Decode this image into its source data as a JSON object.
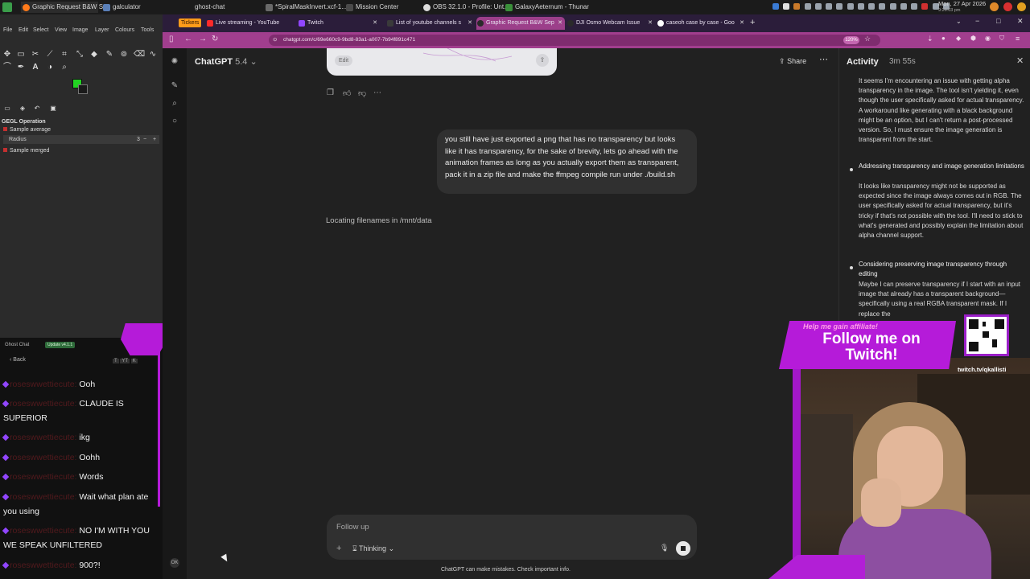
{
  "taskbar": {
    "items": [
      {
        "label": "Graphic Request B&W S...",
        "active": true,
        "color": "#ff7a1a"
      },
      {
        "label": "galculator",
        "active": false,
        "color": "#5a7fb8"
      },
      {
        "label": "ghost-chat",
        "active": false,
        "color": "#2b2b2b"
      },
      {
        "label": "*SpiralMaskInvert.xcf-1...",
        "active": false,
        "color": "#6a6a6a"
      },
      {
        "label": "Mission Center",
        "active": false,
        "color": "#4a4a4a"
      },
      {
        "label": "OBS 32.1.0 - Profile: Unt...",
        "active": false,
        "color": "#ddd"
      },
      {
        "label": "GalaxyAeternum - Thunar",
        "active": false,
        "color": "#3a8f3a"
      }
    ],
    "clock_line1": "Mon, 27 Apr 2026",
    "clock_line2": "9:26:03 pm"
  },
  "gimp": {
    "menu": [
      "File",
      "Edit",
      "Select",
      "View",
      "Image",
      "Layer",
      "Colours",
      "Tools"
    ],
    "gegl_title": "GEGL Operation",
    "option1": "Sample average",
    "radius_label": "Radius",
    "radius_value": "3",
    "option2": "Sample merged",
    "fg_color": "#22d322"
  },
  "ghost_chat": {
    "title": "Ghost Chat",
    "badge": "Update v4.1.1",
    "back": "Back",
    "messages": [
      {
        "user": "roseswwettiecute:",
        "text": "Ooh"
      },
      {
        "user": "roseswwettiecute:",
        "text": "CLAUDE IS SUPERIOR"
      },
      {
        "user": "roseswwettiecute:",
        "text": "ikg"
      },
      {
        "user": "roseswwettiecute:",
        "text": "Oohh"
      },
      {
        "user": "roseswwettiecute:",
        "text": "Words"
      },
      {
        "user": "roseswwettiecute:",
        "text": "Wait what plan ate you using"
      },
      {
        "user": "roseswwettiecute:",
        "text": "NO I'M WITH YOU WE SPEAK UNFILTERED"
      },
      {
        "user": "roseswwettiecute:",
        "text": "900?!"
      }
    ]
  },
  "browser": {
    "tabs_label": "Tickers",
    "tabs": [
      {
        "label": "Live streaming - YouTube",
        "color": "#ff2a2a"
      },
      {
        "label": "Twitch",
        "color": "#9146ff"
      },
      {
        "label": "List of youtube channels s",
        "color": "#3a3a3a"
      },
      {
        "label": "Graphic Request B&W Sep",
        "color": "#2a2a2a",
        "active": true
      },
      {
        "label": "DJI Osmo Webcam Issue",
        "color": "#2a2a2a"
      },
      {
        "label": "caseoh case by case - Goo",
        "color": "#ffffff"
      }
    ],
    "url": "chatgpt.com/c/69e660c9-9bd8-83a1-a007-7b94f891c471",
    "zoom": "120%"
  },
  "chatgpt": {
    "title": "ChatGPT",
    "version": "5.4",
    "share": "Share",
    "edit_button": "Edit",
    "user_message": "you still have just exported a png that has no transparency but looks like it has transparency, for the sake of brevity, lets go ahead with the animation frames as long as you actually export them as transparent, pack it in a zip file and make the ffmpeg compile run under ./build.sh",
    "status": "Locating filenames in /mnt/data",
    "composer_placeholder": "Follow up",
    "mode": "Thinking",
    "disclaimer": "ChatGPT can make mistakes. Check important info."
  },
  "activity": {
    "title": "Activity",
    "duration": "3m 55s",
    "intro": "It seems I'm encountering an issue with getting alpha transparency in the image. The tool isn't yielding it, even though the user specifically asked for actual transparency. A workaround like generating with a black background might be an option, but I can't return a post-processed version. So, I must ensure the image generation is transparent from the start.",
    "items": [
      {
        "heading": "Addressing transparency and image generation limitations",
        "body": "It looks like transparency might not be supported as expected since the image always comes out in RGB. The user specifically asked for actual transparency, but it's tricky if that's not possible with the tool. I'll need to stick to what's generated and possibly explain the limitation about alpha channel support."
      },
      {
        "heading": "Considering preserving image transparency through editing",
        "body": "Maybe I can preserve transparency if I start with an input image that already has a transparent background—specifically using a real RGBA transparent mask. If I replace the"
      }
    ]
  },
  "overlay": {
    "tagline": "Help me gain affiliate!",
    "headline": "Follow me on Twitch!",
    "handle": "twitch.tv/qkallisti",
    "accent": "#b51bd9"
  }
}
